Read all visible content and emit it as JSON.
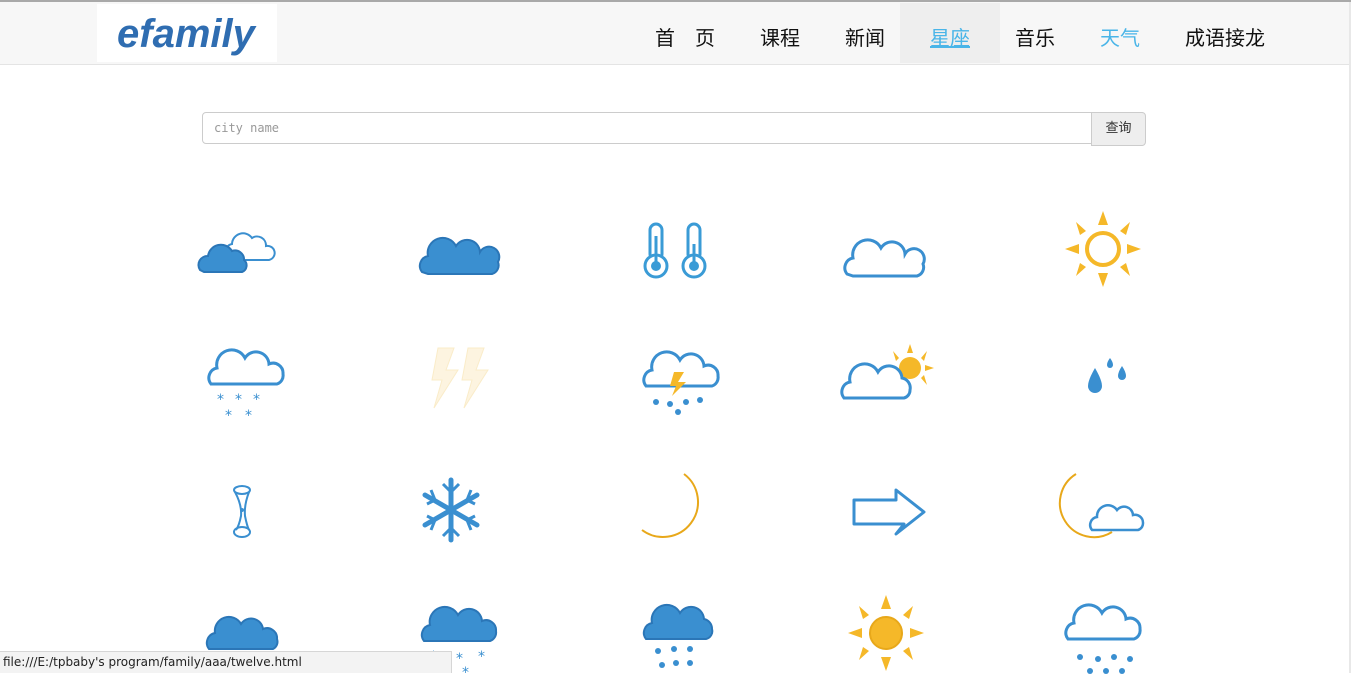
{
  "logo": {
    "text": "efamily"
  },
  "nav": {
    "items": [
      {
        "label": "首　页"
      },
      {
        "label": "课程"
      },
      {
        "label": "新闻"
      },
      {
        "label": "星座"
      },
      {
        "label": "音乐"
      },
      {
        "label": "天气"
      },
      {
        "label": "成语接龙"
      }
    ]
  },
  "search": {
    "placeholder": "city name",
    "value": "",
    "button_label": "查询"
  },
  "weather_icons": [
    "partly-cloudy-icon",
    "cloudy-icon",
    "temperature-icon",
    "overcast-icon",
    "sunny-icon",
    "snow-shower-icon",
    "thunder-icon",
    "thunderstorm-icon",
    "sun-behind-cloud-icon",
    "drizzle-icon",
    "wind-icon",
    "snowflake-icon",
    "moon-icon",
    "arrow-icon",
    "moon-cloud-icon",
    "dark-cloud-icon",
    "heavy-snow-icon",
    "rain-icon",
    "bright-sun-icon",
    "rain-shower-icon"
  ],
  "status_bar": {
    "url": "file:///E:/tpbaby's  program/family/aaa/twelve.html"
  },
  "colors": {
    "accent": "#4ab5e8",
    "brand": "#2f6db1",
    "cloud_blue": "#3a8fd0",
    "sun_yellow": "#f5b829"
  }
}
